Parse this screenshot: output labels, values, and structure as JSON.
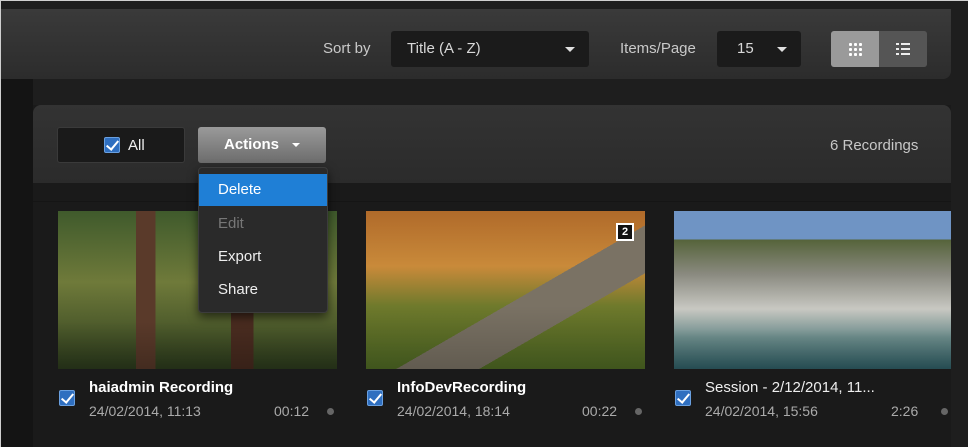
{
  "toolbar": {
    "sort_label": "Sort by",
    "sort_value": "Title (A - Z)",
    "items_label": "Items/Page",
    "items_value": "15",
    "view_grid_icon": "grid-icon",
    "view_list_icon": "list-icon"
  },
  "selection": {
    "all_label": "All",
    "all_checked": true
  },
  "actions": {
    "label": "Actions",
    "menu": [
      {
        "label": "Delete",
        "state": "active"
      },
      {
        "label": "Edit",
        "state": "disabled"
      },
      {
        "label": "Export",
        "state": "normal"
      },
      {
        "label": "Share",
        "state": "normal"
      }
    ]
  },
  "count_label": "6 Recordings",
  "recordings": [
    {
      "title": "haiadmin Recording",
      "date": "24/02/2014, 11:13",
      "duration": "00:12",
      "checked": true
    },
    {
      "title": "InfoDevRecording",
      "date": "24/02/2014, 18:14",
      "duration": "00:22",
      "checked": true,
      "badge": "2"
    },
    {
      "title": "Session - 2/12/2014, 11...",
      "date": "24/02/2014, 15:56",
      "duration": "2:26",
      "checked": true
    }
  ],
  "colors": {
    "accent": "#1f7fd6",
    "checkbox": "#2f6fc0",
    "background": "#1e1e1e"
  }
}
